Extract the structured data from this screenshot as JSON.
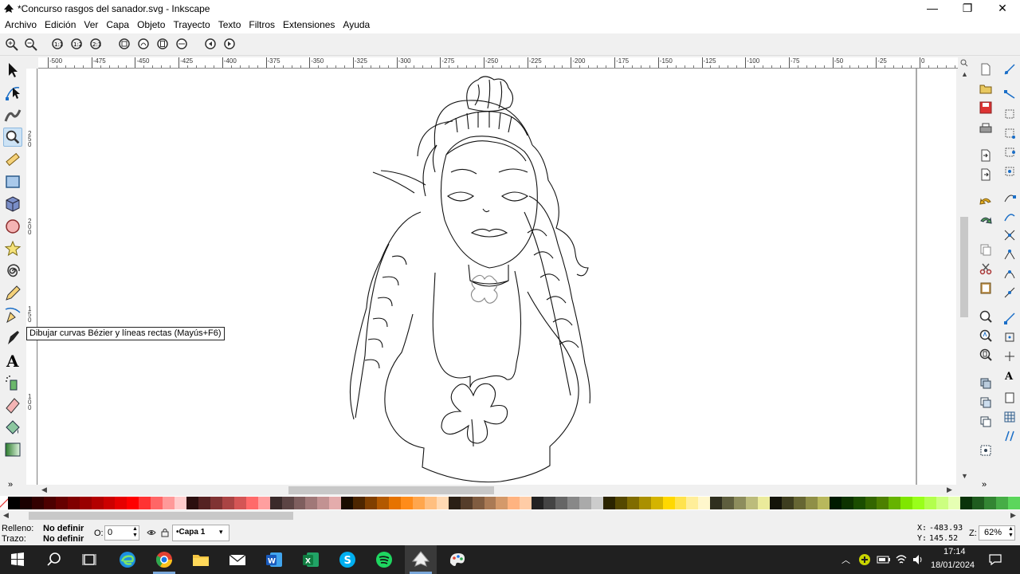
{
  "window": {
    "title": "*Concurso rasgos del sanador.svg - Inkscape",
    "minimize": "—",
    "maximize": "❐",
    "close": "✕"
  },
  "menu": [
    "Archivo",
    "Edición",
    "Ver",
    "Capa",
    "Objeto",
    "Trayecto",
    "Texto",
    "Filtros",
    "Extensiones",
    "Ayuda"
  ],
  "ruler": {
    "h_labels": [
      "-500",
      "-475",
      "-450",
      "-425",
      "-400",
      "-375",
      "-350",
      "-325",
      "-300",
      "-275",
      "-250",
      "-225",
      "-200",
      "-175",
      "-150",
      "-125",
      "-100",
      "-75",
      "-50",
      "-25",
      "0"
    ],
    "v_labels": [
      "250",
      "200",
      "150",
      "100"
    ]
  },
  "tooltip": "Dibujar curvas Bézier y líneas rectas (Mayús+F6)",
  "status": {
    "fill_label": "Relleno:",
    "fill_value": "No definir",
    "stroke_label": "Trazo:",
    "stroke_value": "No definir",
    "opacity_label": "O:",
    "opacity_value": "0",
    "layer": "•Capa 1",
    "x_label": "X:",
    "x_value": "-483.93",
    "y_label": "Y:",
    "y_value": "145.52",
    "zoom_label": "Z:",
    "zoom_value": "62%"
  },
  "taskbar": {
    "time": "17:14",
    "date": "18/01/2024"
  },
  "palette": [
    "#000000",
    "#1a0000",
    "#330000",
    "#4d0000",
    "#660000",
    "#800000",
    "#990000",
    "#b30000",
    "#cc0000",
    "#e60000",
    "#ff0000",
    "#ff3333",
    "#ff6666",
    "#ff9999",
    "#ffcccc",
    "#2b0f0f",
    "#552222",
    "#803333",
    "#aa4444",
    "#d45555",
    "#ff6a6a",
    "#ff9f9f",
    "#3a2a2a",
    "#5c4444",
    "#7e5e5e",
    "#a07878",
    "#c29292",
    "#e4acac",
    "#1a0d00",
    "#4d2600",
    "#803f00",
    "#b35900",
    "#e67300",
    "#ff8c1a",
    "#ffa64d",
    "#ffbf80",
    "#ffd9b3",
    "#2a1f15",
    "#553d2a",
    "#805c40",
    "#aa7a55",
    "#d4996a",
    "#ffb380",
    "#ffcca6",
    "#222222",
    "#444444",
    "#666666",
    "#888888",
    "#aaaaaa",
    "#cccccc",
    "#2b2400",
    "#554800",
    "#806c00",
    "#aa9000",
    "#d4b400",
    "#ffd800",
    "#ffe34d",
    "#ffee99",
    "#fff7cc",
    "#2f2f1f",
    "#5e5e3e",
    "#8d8d5d",
    "#bcbc7c",
    "#ebeb9b",
    "#14140a",
    "#3d3d1f",
    "#666633",
    "#8f8f47",
    "#b8b85c",
    "#001a00",
    "#0d3300",
    "#1a4d00",
    "#336600",
    "#4d8000",
    "#66b300",
    "#80e600",
    "#99ff1a",
    "#b3ff4d",
    "#ccff80",
    "#e6ffb3",
    "#0a330a",
    "#1f5c1f",
    "#338533",
    "#47ad47",
    "#5cd65c"
  ],
  "vruler_label": "1\n5\n0",
  "bottom_arrows": "»"
}
